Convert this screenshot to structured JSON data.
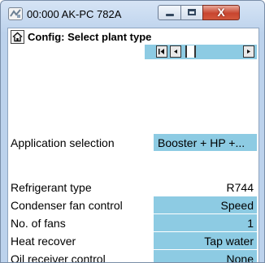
{
  "window": {
    "title": "00:000 AK-PC 782A",
    "close_symbol": "X"
  },
  "header": {
    "page_title": "Config: Select plant type"
  },
  "navigation": {
    "prev_end_symbol": "|<",
    "prev_symbol": "<",
    "next_end_symbol": ">|"
  },
  "settings": {
    "application_selection": {
      "label": "Application selection",
      "value": "Booster + HP +..."
    },
    "refrigerant_type": {
      "label": "Refrigerant type",
      "value": "R744"
    },
    "condenser_fan_control": {
      "label": "Condenser fan control",
      "value": "Speed"
    },
    "no_of_fans": {
      "label": "No. of fans",
      "value": "1"
    },
    "heat_recover": {
      "label": "Heat recover",
      "value": "Tap water"
    },
    "oil_receiver_control": {
      "label": "Oil receiver control",
      "value": "None"
    }
  },
  "colors": {
    "field_background": "#8dcbe3",
    "title_bar": "#bcd2ec",
    "close_button": "#c8452f"
  },
  "icons": {
    "app": "ak-pc-app-icon",
    "home": "home-icon"
  }
}
